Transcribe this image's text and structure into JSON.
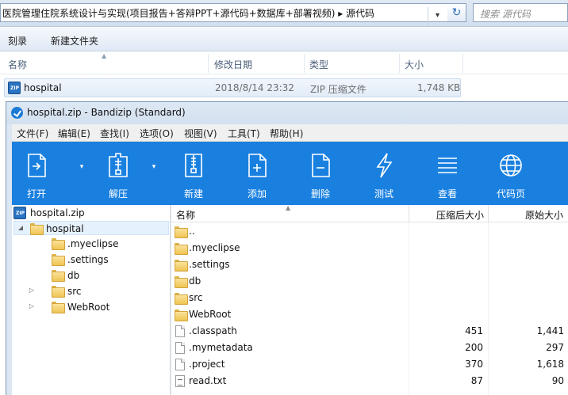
{
  "explorer": {
    "address": "医院管理住院系统设计与实现(项目报告+答辩PPT+源代码+数据库+部署视频)  ▸  源代码",
    "search_placeholder": "搜索 源代码",
    "commands": [
      "刻录",
      "新建文件夹"
    ],
    "columns": {
      "name": "名称",
      "date": "修改日期",
      "type": "类型",
      "size": "大小"
    },
    "file": {
      "name": "hospital",
      "date": "2018/8/14 23:32",
      "type": "ZIP 压缩文件",
      "size": "1,748 KB"
    }
  },
  "bandizip": {
    "title": "hospital.zip - Bandizip (Standard)",
    "menu": [
      "文件(F)",
      "编辑(E)",
      "查找(I)",
      "选项(O)",
      "视图(V)",
      "工具(T)",
      "帮助(H)"
    ],
    "toolbar": [
      {
        "label": "打开",
        "icon": "open-icon"
      },
      {
        "label": "解压",
        "icon": "extract-icon"
      },
      {
        "label": "新建",
        "icon": "new-archive-icon"
      },
      {
        "label": "添加",
        "icon": "add-file-icon"
      },
      {
        "label": "删除",
        "icon": "delete-file-icon"
      },
      {
        "label": "测试",
        "icon": "test-icon"
      },
      {
        "label": "查看",
        "icon": "view-icon"
      },
      {
        "label": "代码页",
        "icon": "codepage-icon"
      }
    ],
    "tree": {
      "root": "hospital.zip",
      "folder": "hospital",
      "children": [
        ".myeclipse",
        ".settings",
        "db",
        "src",
        "WebRoot"
      ]
    },
    "list": {
      "columns": {
        "name": "名称",
        "compressed": "压缩后大小",
        "original": "原始大小"
      },
      "rows": [
        {
          "name": "..",
          "type": "folder",
          "compressed": "",
          "original": ""
        },
        {
          "name": ".myeclipse",
          "type": "folder",
          "compressed": "",
          "original": ""
        },
        {
          "name": ".settings",
          "type": "folder",
          "compressed": "",
          "original": ""
        },
        {
          "name": "db",
          "type": "folder",
          "compressed": "",
          "original": ""
        },
        {
          "name": "src",
          "type": "folder",
          "compressed": "",
          "original": ""
        },
        {
          "name": "WebRoot",
          "type": "folder",
          "compressed": "",
          "original": ""
        },
        {
          "name": ".classpath",
          "type": "file",
          "compressed": "451",
          "original": "1,441"
        },
        {
          "name": ".mymetadata",
          "type": "file",
          "compressed": "200",
          "original": "297"
        },
        {
          "name": ".project",
          "type": "file",
          "compressed": "370",
          "original": "1,618"
        },
        {
          "name": "read.txt",
          "type": "txt",
          "compressed": "87",
          "original": "90"
        }
      ]
    }
  },
  "colors": {
    "toolbar_blue": "#1a80e0",
    "selection": "#e5f1fc",
    "folder": "#f0c453"
  }
}
